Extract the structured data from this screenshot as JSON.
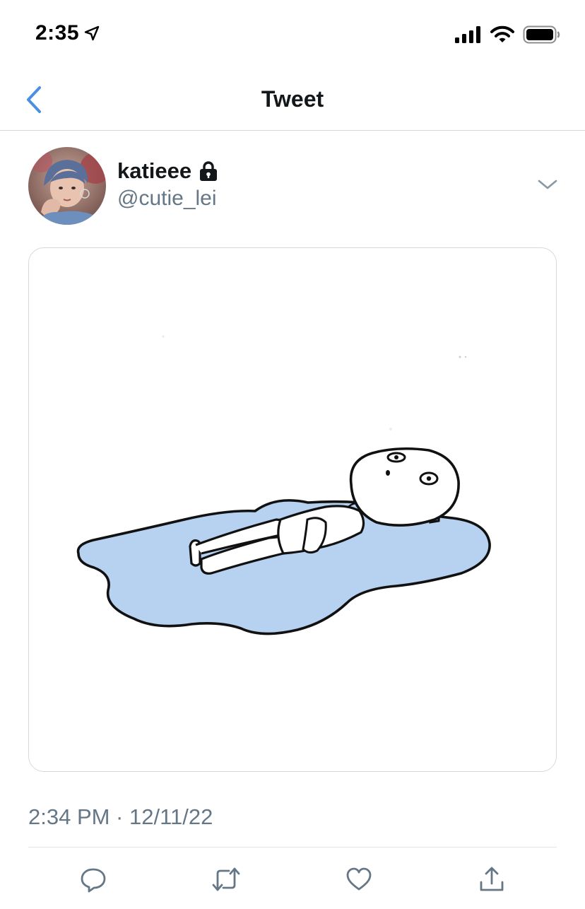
{
  "status_bar": {
    "time": "2:35",
    "icons": [
      "location-arrow-icon",
      "cellular-signal-icon",
      "wifi-icon",
      "battery-icon"
    ]
  },
  "nav": {
    "title": "Tweet",
    "back_icon": "chevron-left-icon"
  },
  "tweet": {
    "author": {
      "display_name": "katieee",
      "handle": "@cutie_lei",
      "protected_icon": "lock-icon"
    },
    "media": {
      "description_icon": "puddle-crying-figure-illustration"
    },
    "timestamp": "2:34 PM · 12/11/22",
    "more_icon": "chevron-down-icon"
  },
  "actions": [
    {
      "name": "reply",
      "icon": "reply-icon"
    },
    {
      "name": "retweet",
      "icon": "retweet-icon"
    },
    {
      "name": "like",
      "icon": "heart-icon"
    },
    {
      "name": "share",
      "icon": "share-icon"
    }
  ],
  "colors": {
    "accent": "#1DA1F2",
    "back_chevron": "#4A90E2",
    "secondary_text": "#657786",
    "icon_gray": "#657786",
    "puddle": "#B7D1F0"
  }
}
